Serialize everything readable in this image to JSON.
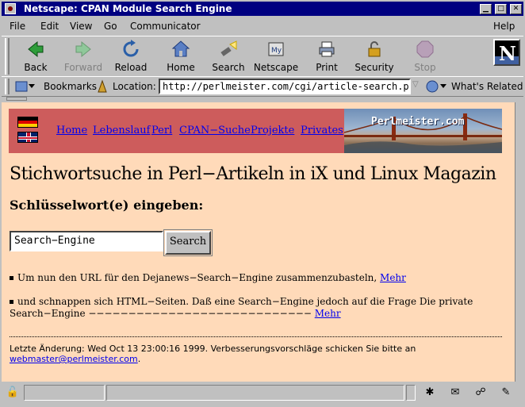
{
  "window": {
    "title": "Netscape: CPAN Module Search Engine",
    "controls": [
      "▁",
      "□",
      "✕"
    ]
  },
  "menubar": {
    "items": [
      "File",
      "Edit",
      "View",
      "Go",
      "Communicator"
    ],
    "help": "Help"
  },
  "toolbar": {
    "back": "Back",
    "forward": "Forward",
    "reload": "Reload",
    "home": "Home",
    "search": "Search",
    "netscape": "Netscape",
    "print": "Print",
    "security": "Security",
    "stop": "Stop"
  },
  "location_bar": {
    "bookmarks": "Bookmarks",
    "location_label": "Location:",
    "url": "http://perlmeister.com/cgi/article-search.pl",
    "whats_related": "What's Related"
  },
  "page": {
    "nav": [
      "Home",
      "Lebenslauf",
      "Perl",
      "CPAN−Suche",
      "Projekte",
      "Privates"
    ],
    "banner_text": "Perlmeister.com",
    "heading": "Stichwortsuche in Perl−Artikeln in iX und Linux Magazin",
    "subheading": "Schlüsselwort(e) eingeben:",
    "search_value": "Search−Engine",
    "search_button": "Search",
    "result1_text": "Um nun den URL für den Dejanews−Search−Engine zusammenzubasteln,",
    "result1_link": "Mehr",
    "result2_line1": "und schnappen sich HTML−Seiten. Daß eine Search−Engine jedoch auf die Frage Die private",
    "result2_line2": "Search−Engine −−−−−−−−−−−−−−−−−−−−−−−−−−−−",
    "result2_link": "Mehr",
    "footer_text": "Letzte Änderung: Wed Oct 13 23:00:16 1999. Verbesserungsvorschläge schicken Sie bitte an",
    "footer_email": "webmaster@perlmeister.com",
    "footer_end": "."
  }
}
